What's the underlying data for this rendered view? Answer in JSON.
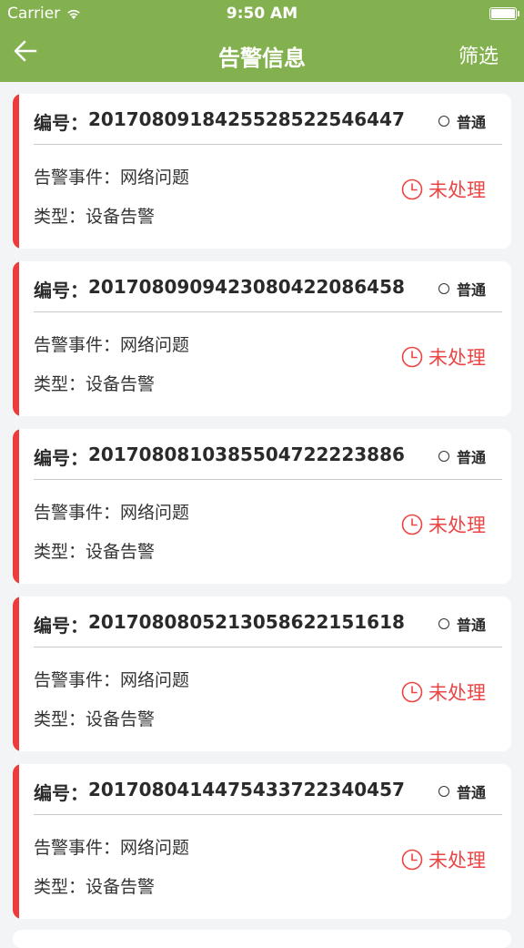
{
  "status_bar": {
    "carrier": "Carrier",
    "time": "9:50 AM"
  },
  "nav": {
    "title": "告警信息",
    "filter_label": "筛选",
    "back_icon": "arrow-left-icon"
  },
  "colors": {
    "nav_bg": "#84b14f",
    "accent_red": "#ee3b3b",
    "status_red": "#e94545"
  },
  "alarms": [
    {
      "id_label": "编号：",
      "id": "20170809184255285225464​47",
      "level": "普通",
      "event_label": "告警事件：",
      "event": "网络问题",
      "type_label": "类型：",
      "type": "设备告警",
      "status": "未处理"
    },
    {
      "id_label": "编号：",
      "id": "20170809094230804220864​58",
      "level": "普通",
      "event_label": "告警事件：",
      "event": "网络问题",
      "type_label": "类型：",
      "type": "设备告警",
      "status": "未处理"
    },
    {
      "id_label": "编号：",
      "id": "20170808103855047222238​86",
      "level": "普通",
      "event_label": "告警事件：",
      "event": "网络问题",
      "type_label": "类型：",
      "type": "设备告警",
      "status": "未处理"
    },
    {
      "id_label": "编号：",
      "id": "20170808052130586221516​18",
      "level": "普通",
      "event_label": "告警事件：",
      "event": "网络问题",
      "type_label": "类型：",
      "type": "设备告警",
      "status": "未处理"
    },
    {
      "id_label": "编号：",
      "id": "20170804144754337223404​57",
      "level": "普通",
      "event_label": "告警事件：",
      "event": "网络问题",
      "type_label": "类型：",
      "type": "设备告警",
      "status": "未处理"
    }
  ]
}
